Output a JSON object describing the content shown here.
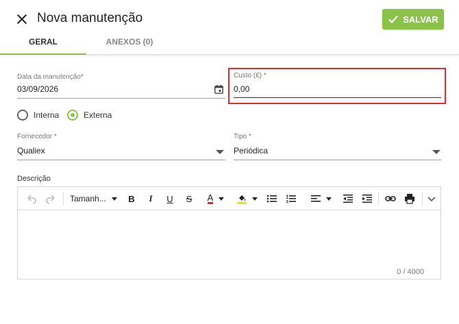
{
  "header": {
    "title": "Nova manutenção",
    "save_label": "SALVAR",
    "accent_color": "#8bc34a"
  },
  "tabs": [
    {
      "label": "GERAL",
      "active": true
    },
    {
      "label": "ANEXOS (0)",
      "active": false
    }
  ],
  "form": {
    "date": {
      "label": "Data da manutenção*",
      "value": "03/09/2026",
      "icon": "calendar-icon"
    },
    "cost": {
      "label": "Custo (€) *",
      "value": "0,00",
      "highlight_color": "#e0282e"
    },
    "location_type": {
      "options": [
        {
          "label": "Interna",
          "selected": false
        },
        {
          "label": "Externa",
          "selected": true
        }
      ]
    },
    "supplier": {
      "label": "Fornecedor *",
      "value": "Qualiex"
    },
    "type": {
      "label": "Tipo *",
      "value": "Periódica"
    },
    "description": {
      "label": "Descrição",
      "counter": "0 / 4000",
      "toolbar": {
        "font_size_label": "Tamanh...",
        "bold": "B",
        "italic": "I",
        "underline": "U",
        "strike": "S",
        "font_color": "A",
        "font_color_value": "#e0282e",
        "highlight_color_value": "#f5e000"
      }
    }
  }
}
